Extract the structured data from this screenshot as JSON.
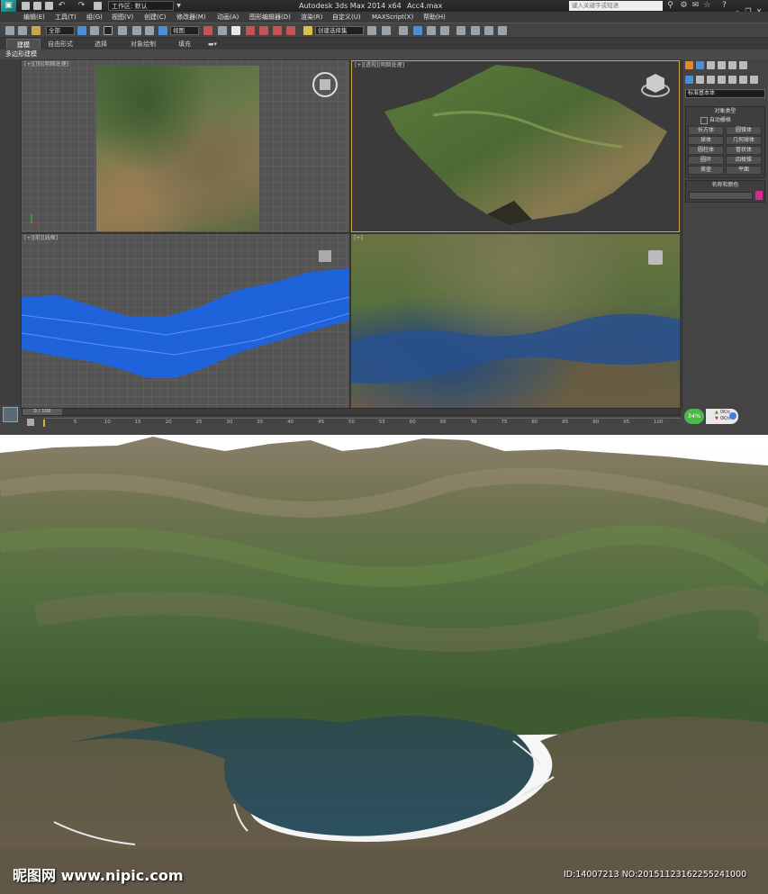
{
  "app": {
    "title": "Autodesk 3ds Max  2014 x64",
    "file": "Acc4.max",
    "workspace": "工作区: 默认",
    "search_placeholder": "键入关键字或短语"
  },
  "menu": [
    "编辑(E)",
    "工具(T)",
    "组(G)",
    "视图(V)",
    "创建(C)",
    "修改器(M)",
    "动画(A)",
    "图形编辑器(D)",
    "渲染(R)",
    "自定义(U)",
    "MAXScript(X)",
    "帮助(H)"
  ],
  "toolbar": {
    "selection_filter": "全部",
    "coord_system": "视图",
    "named_selection": "创建选择集"
  },
  "ribbon": {
    "tabs": [
      "建模",
      "自由形式",
      "选择",
      "对象绘制",
      "填充"
    ],
    "active": "建模",
    "sub_label": "多边形建模"
  },
  "viewports": {
    "top": "[+][顶][明暗处理]",
    "perspective": "[+][透视][明暗处理]",
    "front": "[+][前][线框]",
    "camera": "[+]"
  },
  "command_panel": {
    "category": "标准基本体",
    "object_type_title": "对象类型",
    "autogrid": "自动栅格",
    "buttons": [
      "长方体",
      "圆锥体",
      "球体",
      "几何球体",
      "圆柱体",
      "管状体",
      "圆环",
      "四棱锥",
      "茶壶",
      "平面"
    ],
    "name_color_title": "名称和颜色",
    "color": "#d62b8c"
  },
  "timeline": {
    "frame_display": "0 / 100",
    "ticks": [
      "0",
      "5",
      "10",
      "15",
      "20",
      "25",
      "30",
      "35",
      "40",
      "45",
      "50",
      "55",
      "60",
      "65",
      "70",
      "75",
      "80",
      "85",
      "90",
      "95",
      "100"
    ],
    "progress": "34%",
    "rate_up": "0K/s",
    "rate_down": "0K/s"
  },
  "watermark": {
    "site": "昵图网 www.nipic.com",
    "id": "ID:14007213 NO:20151123162255241000"
  }
}
